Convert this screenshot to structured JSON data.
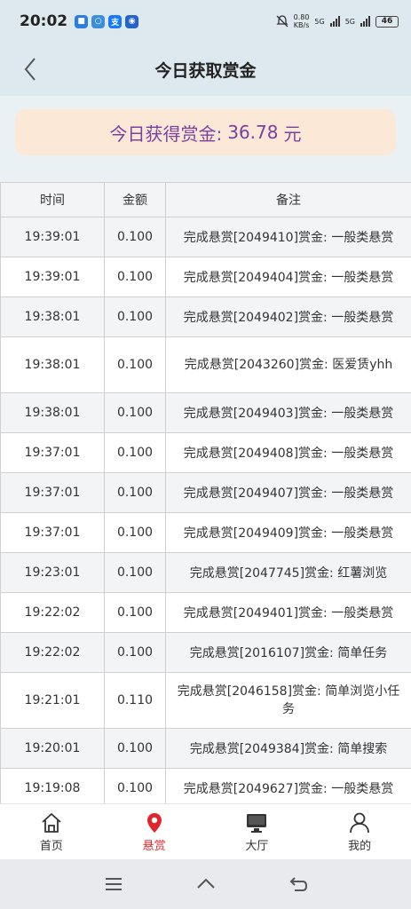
{
  "status_bar": {
    "time": "20:02",
    "speed_value": "0.80",
    "speed_unit": "KB/s",
    "network1": "5G",
    "network2": "5G",
    "battery": "46"
  },
  "header": {
    "title": "今日获取赏金"
  },
  "summary": {
    "label": "今日获得赏金:",
    "amount": "36.78",
    "unit": "元"
  },
  "table": {
    "headers": [
      "时间",
      "金额",
      "备注"
    ],
    "rows": [
      {
        "time": "19:39:01",
        "amount": "0.100",
        "note": "完成悬赏[2049410]赏金: 一般类悬赏"
      },
      {
        "time": "19:39:01",
        "amount": "0.100",
        "note": "完成悬赏[2049404]赏金: 一般类悬赏"
      },
      {
        "time": "19:38:01",
        "amount": "0.100",
        "note": "完成悬赏[2049402]赏金: 一般类悬赏"
      },
      {
        "time": "19:38:01",
        "amount": "0.100",
        "note": "完成悬赏[2043260]赏金: 医爱赁yhh"
      },
      {
        "time": "19:38:01",
        "amount": "0.100",
        "note": "完成悬赏[2049403]赏金: 一般类悬赏"
      },
      {
        "time": "19:37:01",
        "amount": "0.100",
        "note": "完成悬赏[2049408]赏金: 一般类悬赏"
      },
      {
        "time": "19:37:01",
        "amount": "0.100",
        "note": "完成悬赏[2049407]赏金: 一般类悬赏"
      },
      {
        "time": "19:37:01",
        "amount": "0.100",
        "note": "完成悬赏[2049409]赏金: 一般类悬赏"
      },
      {
        "time": "19:23:01",
        "amount": "0.100",
        "note": "完成悬赏[2047745]赏金: 红薯浏览"
      },
      {
        "time": "19:22:02",
        "amount": "0.100",
        "note": "完成悬赏[2049401]赏金: 一般类悬赏"
      },
      {
        "time": "19:22:02",
        "amount": "0.100",
        "note": "完成悬赏[2016107]赏金: 简单任务"
      },
      {
        "time": "19:21:01",
        "amount": "0.110",
        "note": "完成悬赏[2046158]赏金: 简单浏览小任务"
      },
      {
        "time": "19:20:01",
        "amount": "0.100",
        "note": "完成悬赏[2049384]赏金: 简单搜索"
      },
      {
        "time": "19:19:08",
        "amount": "0.100",
        "note": "完成悬赏[2049627]赏金: 一般类悬赏"
      }
    ]
  },
  "bottom_nav": {
    "items": [
      {
        "label": "首页",
        "icon": "home-icon"
      },
      {
        "label": "悬赏",
        "icon": "location-pin-icon"
      },
      {
        "label": "大厅",
        "icon": "monitor-icon"
      },
      {
        "label": "我的",
        "icon": "user-icon"
      }
    ],
    "active_index": 1
  },
  "colors": {
    "accent": "#e0262c",
    "summary_bg": "#fbe8d6",
    "summary_text": "#7b3fa0",
    "header_bg": "#dde9ee"
  }
}
